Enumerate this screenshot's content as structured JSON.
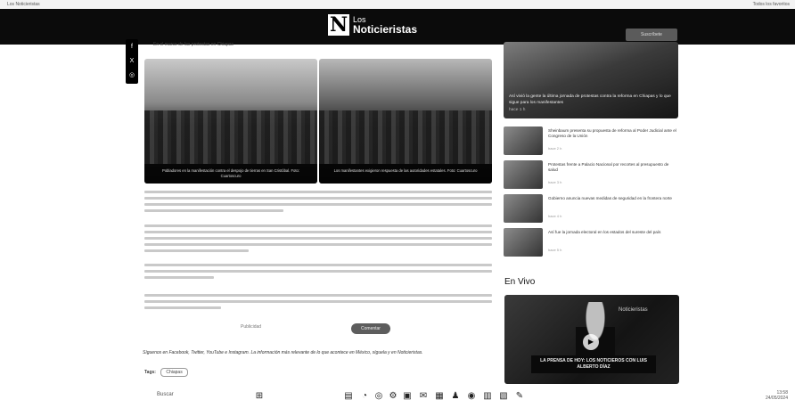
{
  "header": {
    "logo_mark": "N",
    "logo_line1": "Los",
    "logo_line2": "Noticieristas",
    "button_label": "Suscríbete"
  },
  "browser": {
    "left_text": "Los Noticieristas",
    "right_text": "Todos los favoritos"
  },
  "share_icons": [
    "facebook-icon",
    "x-icon",
    "whatsapp-icon"
  ],
  "article": {
    "intro": "En el marco de las protestas en Chiapas",
    "photos": [
      {
        "caption": "Pobladores en la manifestación contra el despojo de tierras en San Cristóbal. Foto: Cuartoscuro"
      },
      {
        "caption": "Los manifestantes exigieron respuesta de las autoridades estatales. Foto: Cuartoscuro"
      }
    ],
    "pager_text": "Publicidad",
    "pill_label": "Comentar",
    "promo": "Síguenos en Facebook, Twitter, YouTube e Instagram. La información más relevante de lo que acontece en México, síguela y en Noticieristas.",
    "tags_label": "Tags:",
    "tags": [
      "Chiapas"
    ]
  },
  "sidebar": {
    "feature": {
      "caption": "Así vivió la gente la última jornada de protestas contra la reforma en Chiapas y lo que sigue para los manifestantes",
      "time": "hace 1 h"
    },
    "items": [
      {
        "title": "Sheinbaum presenta su propuesta de reforma al Poder Judicial ante el Congreso de la Unión",
        "time": "hace 2 h"
      },
      {
        "title": "Protestas frente a Palacio Nacional por recortes al presupuesto de salud",
        "time": "hace 3 h"
      },
      {
        "title": "Gobierno anuncia nuevas medidas de seguridad en la frontera norte",
        "time": "hace 4 h"
      },
      {
        "title": "Así fue la jornada electoral en los estados del sureste del país",
        "time": "hace 5 h"
      }
    ],
    "live_title": "En Vivo",
    "video": {
      "brand": "Noticieristas",
      "banner": "LA PRENSA DE HOY: LOS NOTICIEROS CON LUIS ALBERTO DÍAZ"
    }
  },
  "taskbar": {
    "left": "Buscar",
    "time": "13:58",
    "date": "24/05/2024"
  }
}
